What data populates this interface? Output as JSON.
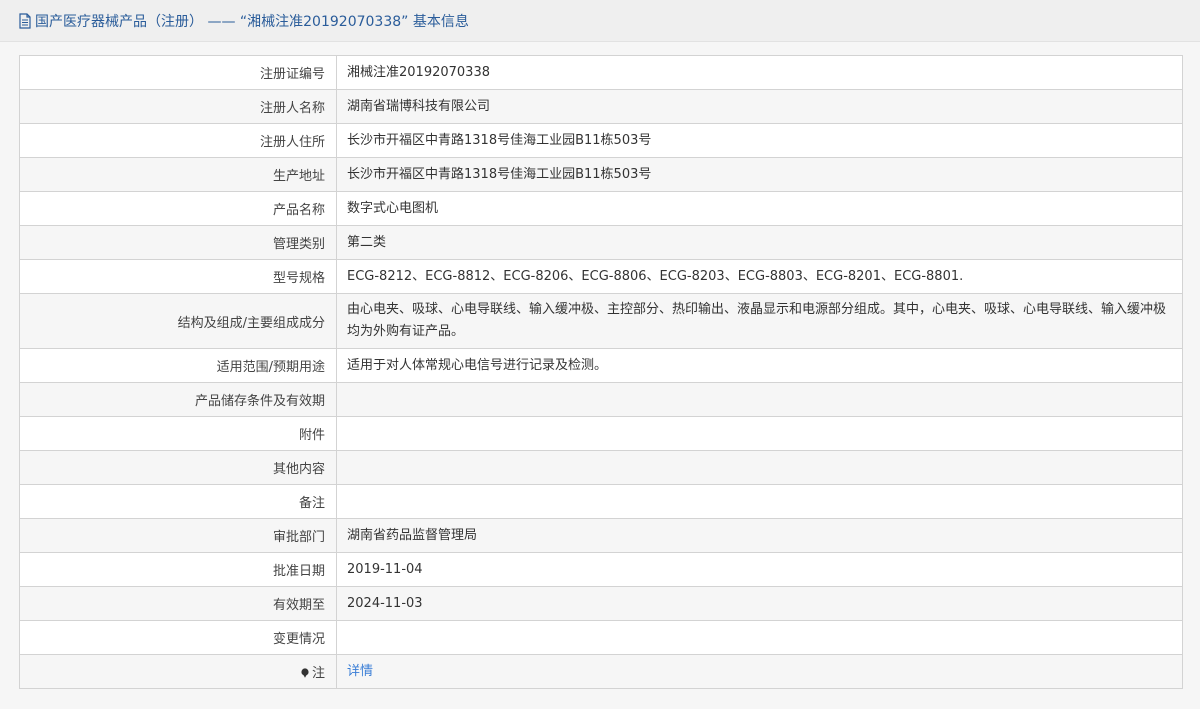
{
  "header": {
    "title": "国产医疗器械产品（注册） —— “湘械注准20192070338” 基本信息"
  },
  "rows": [
    {
      "label": "注册证编号",
      "value": "湘械注准20192070338"
    },
    {
      "label": "注册人名称",
      "value": "湖南省瑞博科技有限公司"
    },
    {
      "label": "注册人住所",
      "value": "长沙市开福区中青路1318号佳海工业园B11栋503号"
    },
    {
      "label": "生产地址",
      "value": "长沙市开福区中青路1318号佳海工业园B11栋503号"
    },
    {
      "label": "产品名称",
      "value": "数字式心电图机"
    },
    {
      "label": "管理类别",
      "value": "第二类"
    },
    {
      "label": "型号规格",
      "value": "ECG-8212、ECG-8812、ECG-8206、ECG-8806、ECG-8203、ECG-8803、ECG-8201、ECG-8801."
    },
    {
      "label": "结构及组成/主要组成成分",
      "value": "由心电夹、吸球、心电导联线、输入缓冲极、主控部分、热印输出、液晶显示和电源部分组成。其中，心电夹、吸球、心电导联线、输入缓冲极均为外购有证产品。"
    },
    {
      "label": "适用范围/预期用途",
      "value": "适用于对人体常规心电信号进行记录及检测。"
    },
    {
      "label": "产品储存条件及有效期",
      "value": ""
    },
    {
      "label": "附件",
      "value": ""
    },
    {
      "label": "其他内容",
      "value": ""
    },
    {
      "label": "备注",
      "value": ""
    },
    {
      "label": "审批部门",
      "value": "湖南省药品监督管理局"
    },
    {
      "label": "批准日期",
      "value": "2019-11-04"
    },
    {
      "label": "有效期至",
      "value": "2024-11-03"
    },
    {
      "label": "变更情况",
      "value": ""
    }
  ],
  "note": {
    "label": "注",
    "link_text": "详情"
  },
  "colors": {
    "header_text": "#2a5c9a",
    "link": "#3a7ed6",
    "border": "#d3d3d3",
    "alt_row": "#f6f6f6"
  }
}
